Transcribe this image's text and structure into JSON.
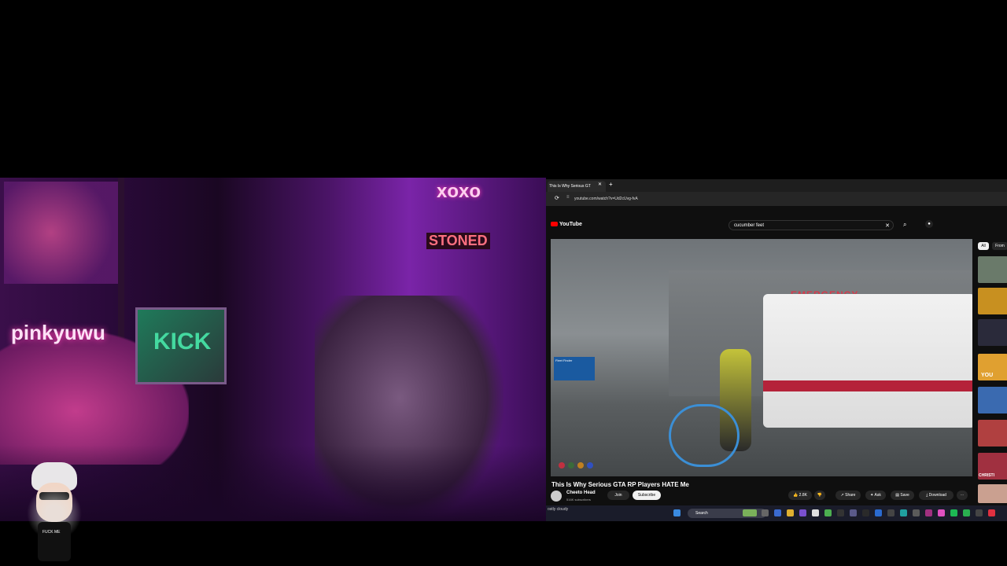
{
  "webcam": {
    "neon_signs": [
      "xoxo",
      "STONED",
      "pinkyuwu",
      "KICK"
    ],
    "avatar_shirt": "FUCK ME"
  },
  "browser": {
    "tab_title": "This Is Why Serious GT",
    "new_tab": "+",
    "url": "youtube.com/watch?v=Ud2cUvg-fvA"
  },
  "youtube": {
    "logo": "YouTube",
    "search_value": "cucumber feet",
    "clear": "✕",
    "video_title": "This Is Why Serious GTA RP Players HATE Me",
    "video_overlay_text": "Fleet Finder",
    "scene_sign": "EMERGENCY",
    "channel_name": "Cheeto Head",
    "subscribers": "516K subscribers",
    "join_label": "Join",
    "subscribe_label": "Subscribe",
    "likes": "2.8K",
    "share_label": "Share",
    "ask_label": "Ask",
    "save_label": "Save",
    "download_label": "Download",
    "chips": [
      "All",
      "From"
    ],
    "sidebar_thumb_text": [
      "YOU",
      "CHRISTI"
    ]
  },
  "taskbar": {
    "weather": "ostly cloudy",
    "search_label": "Search"
  },
  "colors": {
    "youtube_red": "#ff0000",
    "neon_pink": "#ff3fb0",
    "neon_purple": "#b03cff"
  }
}
